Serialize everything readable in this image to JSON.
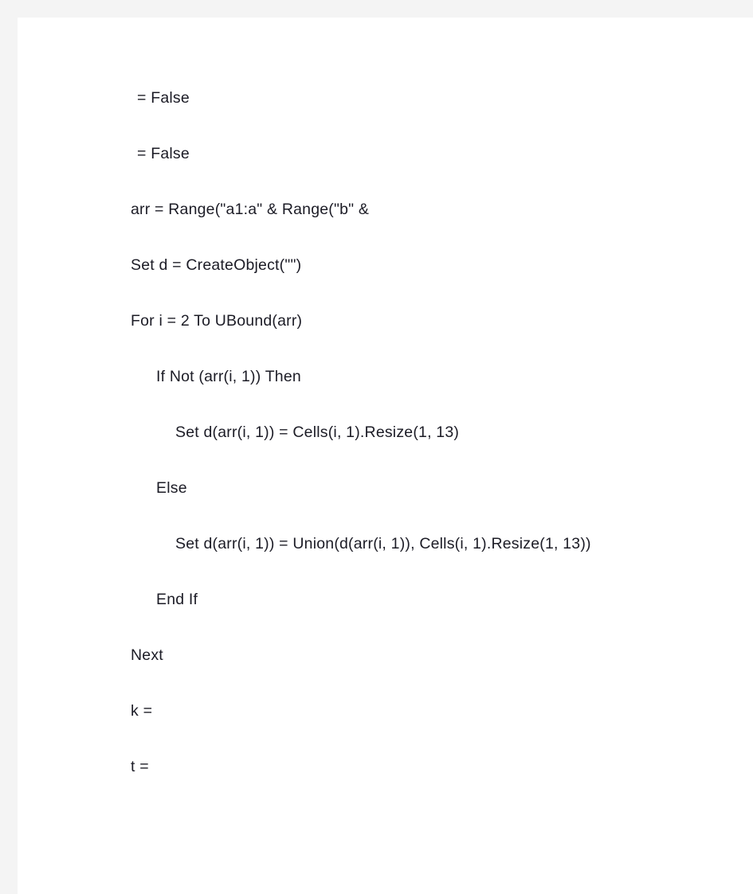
{
  "page": {
    "background_color": "#f4f4f4",
    "surface_color": "#ffffff",
    "text_color": "#1c1c26"
  },
  "document": {
    "lines": [
      {
        "text": "= False",
        "indent": "h"
      },
      {
        "text": "= False",
        "indent": "h"
      },
      {
        "text": "arr = Range(\"a1:a\" & Range(\"b\" &",
        "indent": "0"
      },
      {
        "text": "Set d = CreateObject(\"\")",
        "indent": "0"
      },
      {
        "text": "For i = 2 To UBound(arr)",
        "indent": "0"
      },
      {
        "text": "If Not (arr(i, 1)) Then",
        "indent": "1"
      },
      {
        "text": "Set d(arr(i, 1)) = Cells(i, 1).Resize(1, 13)",
        "indent": "2"
      },
      {
        "text": "Else",
        "indent": "1"
      },
      {
        "text": "Set d(arr(i, 1)) = Union(d(arr(i, 1)), Cells(i, 1).Resize(1, 13))",
        "indent": "2"
      },
      {
        "text": "End If",
        "indent": "1"
      },
      {
        "text": "Next",
        "indent": "0"
      },
      {
        "text": "k =",
        "indent": "0"
      },
      {
        "text": "t =",
        "indent": "0"
      }
    ]
  }
}
